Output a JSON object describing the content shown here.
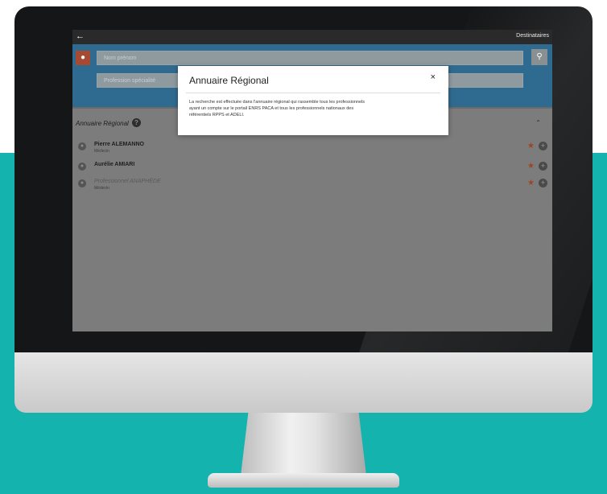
{
  "colors": {
    "teal_background": "#14b3ad",
    "search_band": "#2f6b90",
    "top_bar": "#2a2a2a",
    "avatar": "#a84a31",
    "favorite_star": "#9c4623",
    "screen_overlay": "#7c7c7c"
  },
  "top_bar": {
    "back_icon": "arrow-left-icon",
    "destinataires_label": "Destinataires"
  },
  "search": {
    "avatar_icon": "user-icon",
    "name_placeholder": "Nom prénom",
    "speciality_placeholder": "Profession spécialité",
    "search_icon": "search-icon"
  },
  "section": {
    "title": "Annuaire Régional",
    "help_icon": "question-circle-icon",
    "collapse_icon": "chevron-up-icon"
  },
  "results": [
    {
      "name": "Pierre ALEMANNO",
      "subtitle": "Médecin",
      "muted": false
    },
    {
      "name": "Aurélie AMIARI",
      "subtitle": "",
      "muted": false
    },
    {
      "name": "Professionnel ANAPHÈDE",
      "subtitle": "Médecin",
      "muted": true
    }
  ],
  "modal": {
    "title": "Annuaire Régional",
    "close_label": "×",
    "body_lines": [
      "La recherche est effectuée dans l'annuaire régional qui rassemble tous les professionnels",
      "ayant un compte sur le portail ENRS PACA et tous les professionnels nationaux des",
      "référentiels RPPS et ADELI."
    ]
  }
}
